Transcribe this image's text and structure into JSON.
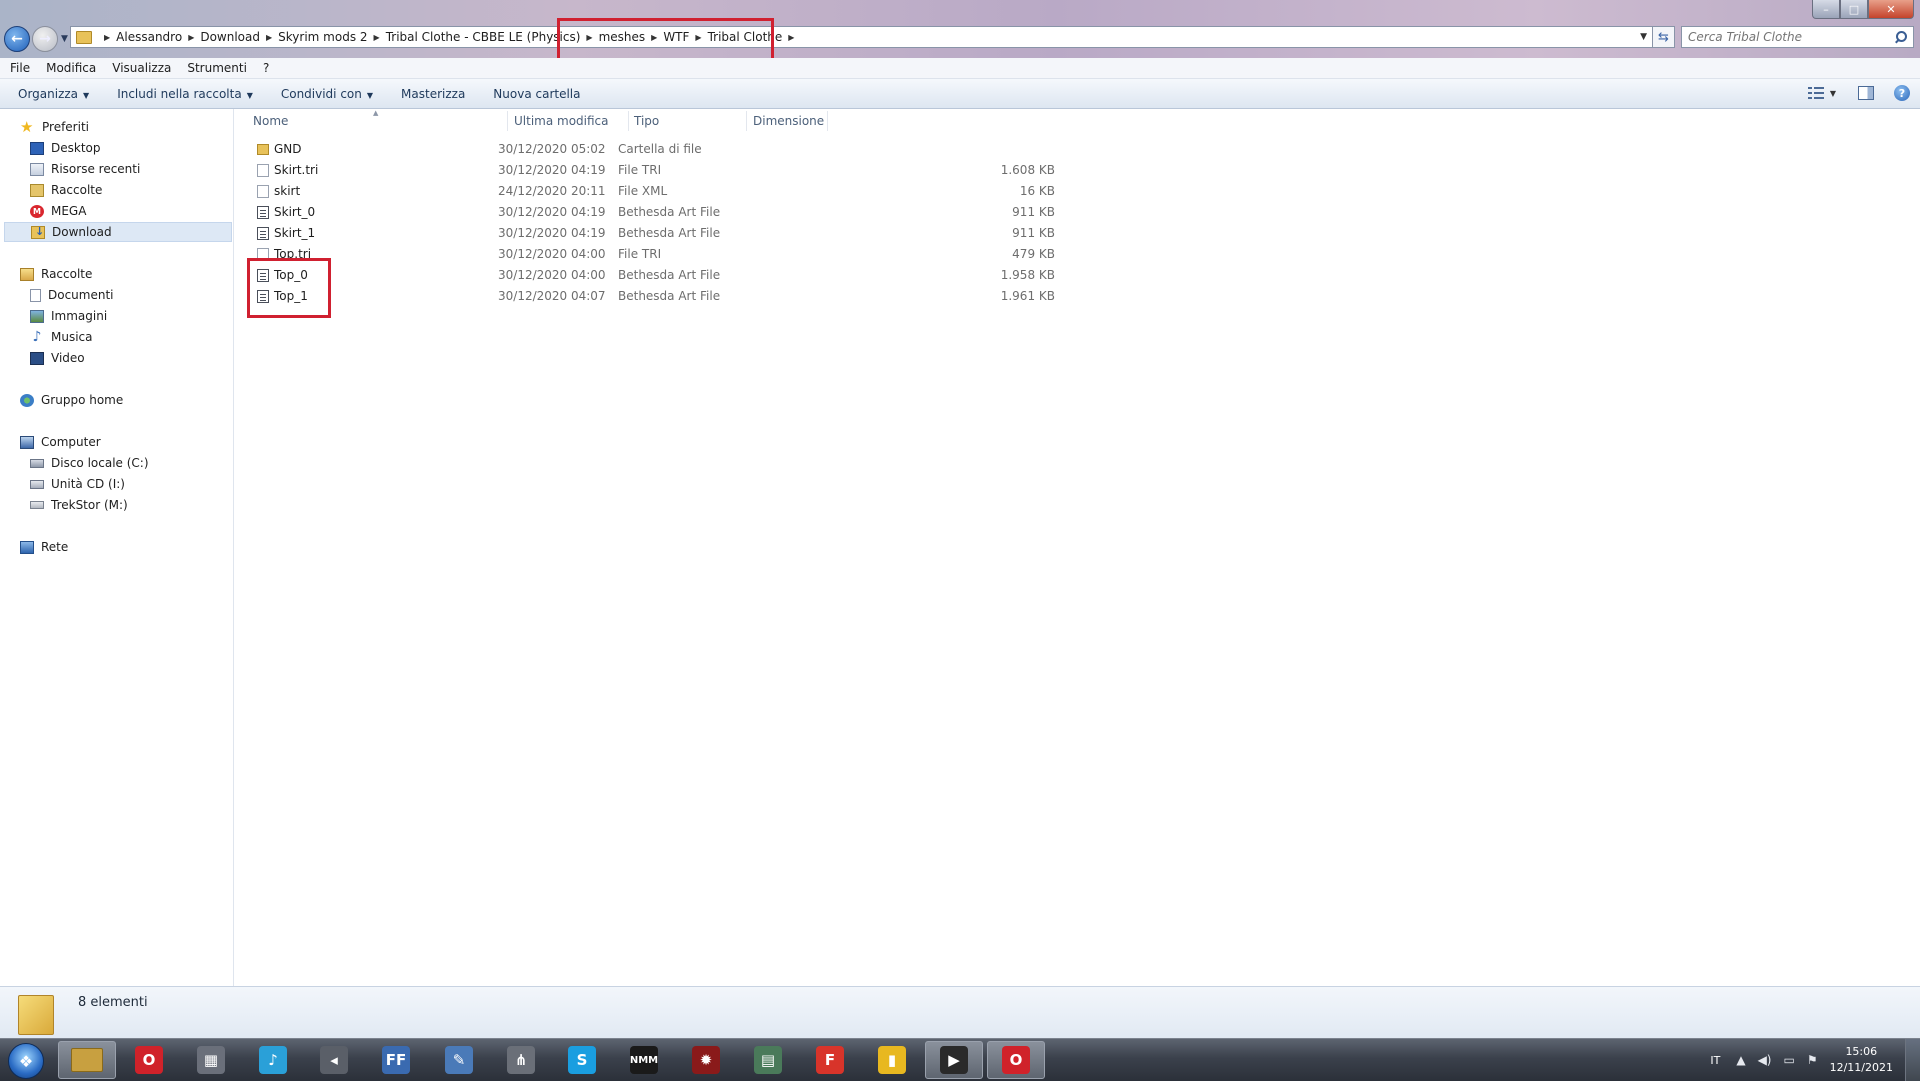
{
  "window": {
    "minimize": "–",
    "maximize": "□",
    "close": "✕"
  },
  "breadcrumb": [
    "Alessandro",
    "Download",
    "Skyrim mods 2",
    "Tribal Clothe - CBBE LE (Physics)",
    "meshes",
    "WTF",
    "Tribal Clothe"
  ],
  "search": {
    "placeholder": "Cerca Tribal Clothe"
  },
  "menu": [
    "File",
    "Modifica",
    "Visualizza",
    "Strumenti",
    "?"
  ],
  "commands": {
    "organize": "Organizza",
    "include": "Includi nella raccolta",
    "share": "Condividi con",
    "burn": "Masterizza",
    "new_folder": "Nuova cartella"
  },
  "sidebar": {
    "favorites": {
      "label": "Preferiti",
      "items": [
        "Desktop",
        "Risorse recenti",
        "Raccolte",
        "MEGA",
        "Download"
      ]
    },
    "libraries": {
      "label": "Raccolte",
      "items": [
        "Documenti",
        "Immagini",
        "Musica",
        "Video"
      ]
    },
    "homegroup": "Gruppo home",
    "computer": {
      "label": "Computer",
      "items": [
        "Disco locale (C:)",
        "Unità CD (I:)",
        "TrekStor (M:)"
      ]
    },
    "network": "Rete",
    "selected": "Download"
  },
  "columns": {
    "name": "Nome",
    "modified": "Ultima modifica",
    "type": "Tipo",
    "size": "Dimensione"
  },
  "files": [
    {
      "name": "GND",
      "modified": "30/12/2020 05:02",
      "type": "Cartella di file",
      "size": "",
      "icon": "folder-icon"
    },
    {
      "name": "Skirt.tri",
      "modified": "30/12/2020 04:19",
      "type": "File TRI",
      "size": "1.608 KB",
      "icon": "file-icon"
    },
    {
      "name": "skirt",
      "modified": "24/12/2020 20:11",
      "type": "File XML",
      "size": "16 KB",
      "icon": "file-icon"
    },
    {
      "name": "Skirt_0",
      "modified": "30/12/2020 04:19",
      "type": "Bethesda Art File",
      "size": "911 KB",
      "icon": "nif-icon"
    },
    {
      "name": "Skirt_1",
      "modified": "30/12/2020 04:19",
      "type": "Bethesda Art File",
      "size": "911 KB",
      "icon": "nif-icon"
    },
    {
      "name": "Top.tri",
      "modified": "30/12/2020 04:00",
      "type": "File TRI",
      "size": "479 KB",
      "icon": "file-icon"
    },
    {
      "name": "Top_0",
      "modified": "30/12/2020 04:00",
      "type": "Bethesda Art File",
      "size": "1.958 KB",
      "icon": "nif-icon"
    },
    {
      "name": "Top_1",
      "modified": "30/12/2020 04:07",
      "type": "Bethesda Art File",
      "size": "1.961 KB",
      "icon": "nif-icon"
    }
  ],
  "status": {
    "item_count": "8 elementi"
  },
  "taskbar": {
    "apps": [
      {
        "glyph": "",
        "color": "#c8a040",
        "name": "explorer"
      },
      {
        "glyph": "O",
        "color": "#d0222a",
        "name": "opera"
      },
      {
        "glyph": "▦",
        "color": "#6a6f7a",
        "name": "media-center"
      },
      {
        "glyph": "♪",
        "color": "#2aa0d8",
        "name": "music-app"
      },
      {
        "glyph": "◂",
        "color": "#5a5f68",
        "name": "speaker-app"
      },
      {
        "glyph": "FF",
        "color": "#3a6ab0",
        "name": "ffdec"
      },
      {
        "glyph": "✎",
        "color": "#4a7ab8",
        "name": "editor-app"
      },
      {
        "glyph": "⋔",
        "color": "#6a6f78",
        "name": "network-app"
      },
      {
        "glyph": "S",
        "color": "#1a9ee0",
        "name": "skype"
      },
      {
        "glyph": "NMM",
        "color": "#1a1a1a",
        "name": "nmm"
      },
      {
        "glyph": "✹",
        "color": "#8a1a1a",
        "name": "game-app"
      },
      {
        "glyph": "▤",
        "color": "#4a7a5a",
        "name": "window-app"
      },
      {
        "glyph": "F",
        "color": "#d8342a",
        "name": "f-app"
      },
      {
        "glyph": "▮",
        "color": "#e8b820",
        "name": "chart-app"
      },
      {
        "glyph": "▶",
        "color": "#2a2a2a",
        "name": "dark-app"
      },
      {
        "glyph": "O",
        "color": "#d0222a",
        "name": "opera-active"
      }
    ],
    "lang": "IT",
    "time": "15:06",
    "date": "12/11/2021"
  }
}
